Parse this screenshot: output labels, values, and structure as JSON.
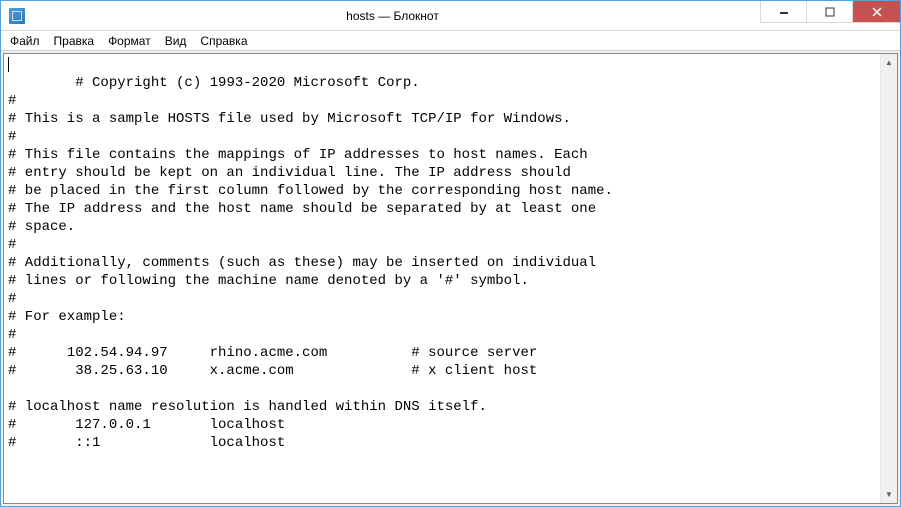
{
  "window": {
    "title": "hosts — Блокнот"
  },
  "menu": {
    "file": "Файл",
    "edit": "Правка",
    "format": "Формат",
    "view": "Вид",
    "help": "Справка"
  },
  "editor": {
    "content": "# Copyright (c) 1993-2020 Microsoft Corp.\n#\n# This is a sample HOSTS file used by Microsoft TCP/IP for Windows.\n#\n# This file contains the mappings of IP addresses to host names. Each\n# entry should be kept on an individual line. The IP address should\n# be placed in the first column followed by the corresponding host name.\n# The IP address and the host name should be separated by at least one\n# space.\n#\n# Additionally, comments (such as these) may be inserted on individual\n# lines or following the machine name denoted by a '#' symbol.\n#\n# For example:\n#\n#      102.54.94.97     rhino.acme.com          # source server\n#       38.25.63.10     x.acme.com              # x client host\n\n# localhost name resolution is handled within DNS itself.\n#       127.0.0.1       localhost\n#       ::1             localhost"
  },
  "icons": {
    "scroll_up": "▲",
    "scroll_down": "▼"
  }
}
